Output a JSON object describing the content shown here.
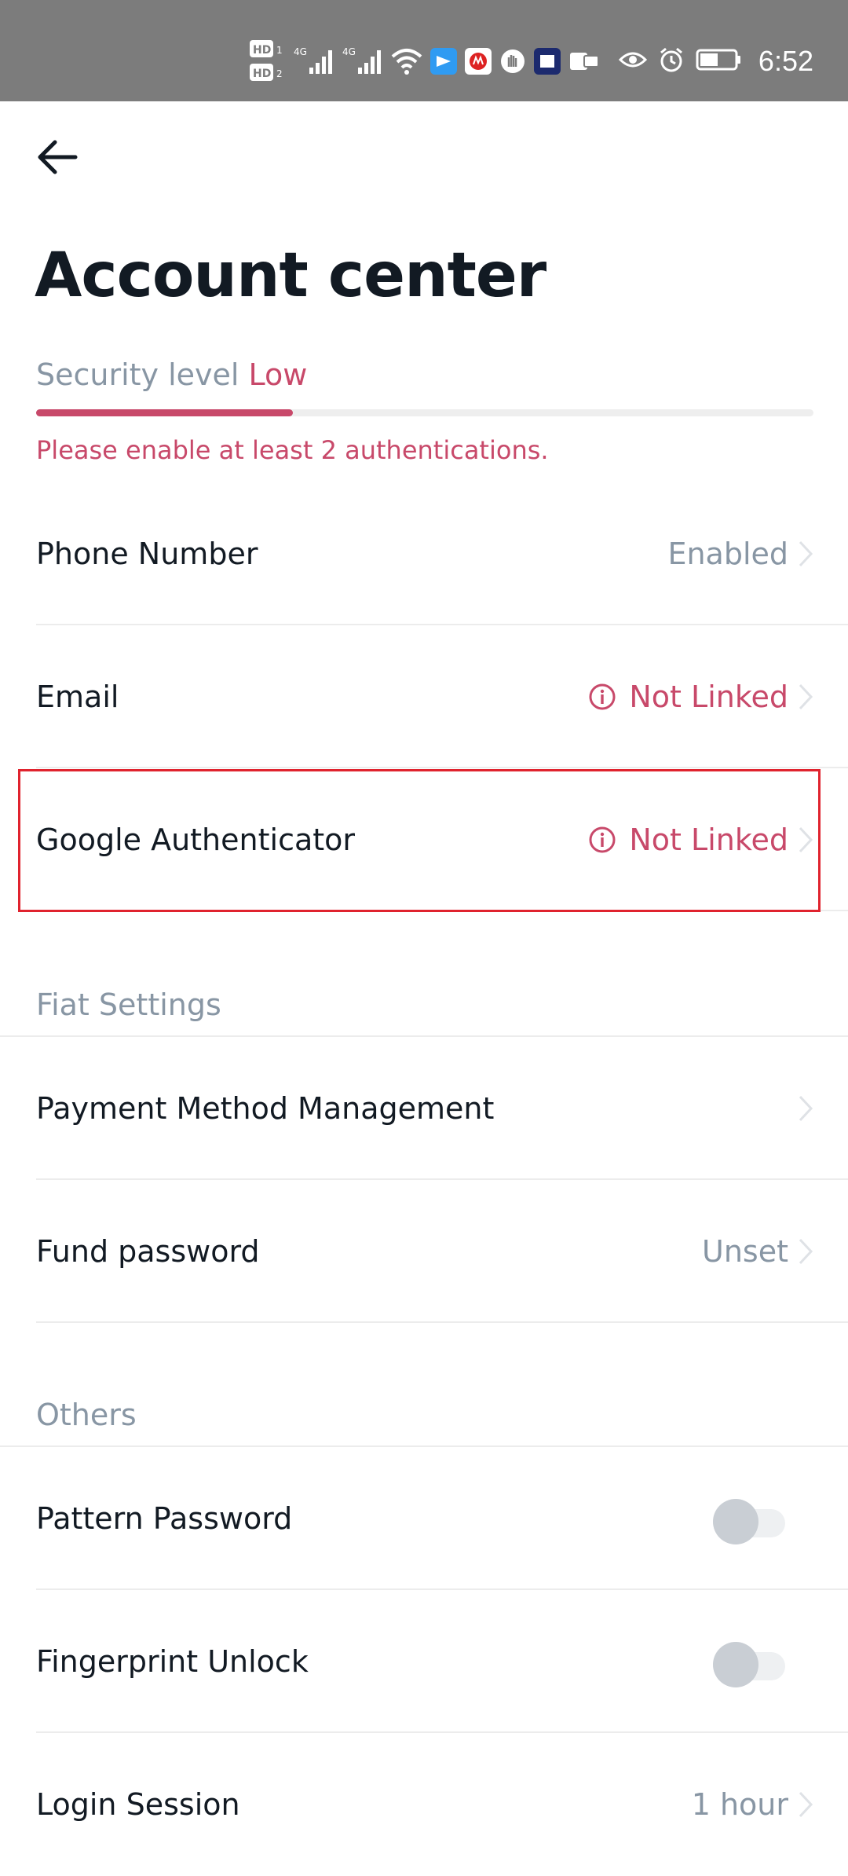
{
  "status_bar": {
    "time": "6:52",
    "icons": [
      "hd-icon",
      "4g-signal-icon",
      "4g-signal-icon",
      "wifi-icon",
      "app-notification-icon",
      "app-notification-icon",
      "app-notification-icon",
      "app-notification-icon",
      "app-notification-icon",
      "eye-icon",
      "alarm-icon",
      "battery-icon"
    ]
  },
  "header": {
    "title": "Account center"
  },
  "security": {
    "label": "Security level",
    "value": "Low",
    "level_percent": 33,
    "warning": "Please enable at least 2 authentications."
  },
  "auth_items": [
    {
      "label": "Phone Number",
      "value": "Enabled",
      "alert": false
    },
    {
      "label": "Email",
      "value": "Not Linked",
      "alert": true
    },
    {
      "label": "Google Authenticator",
      "value": "Not Linked",
      "alert": true
    }
  ],
  "fiat_settings": {
    "header": "Fiat Settings",
    "items": [
      {
        "label": "Payment Method Management",
        "value": ""
      },
      {
        "label": "Fund password",
        "value": "Unset"
      }
    ]
  },
  "others": {
    "header": "Others",
    "items": [
      {
        "label": "Pattern Password",
        "toggle": false
      },
      {
        "label": "Fingerprint Unlock",
        "toggle": false
      },
      {
        "label": "Login Session",
        "value": "1 hour"
      }
    ]
  },
  "colors": {
    "accent": "#c8496a",
    "muted": "#8896a4",
    "text": "#121a23",
    "status_bar": "#7c7c7c",
    "highlight": "#e0232e"
  }
}
